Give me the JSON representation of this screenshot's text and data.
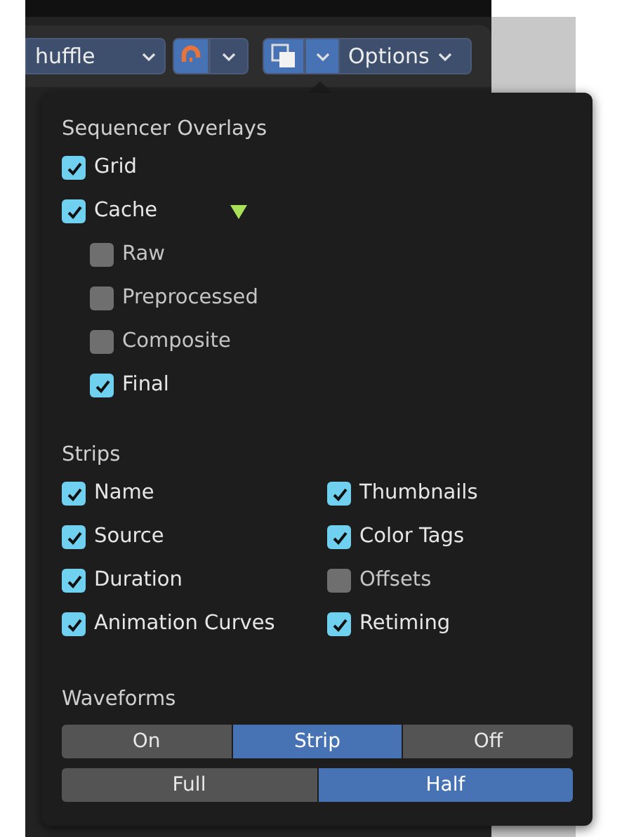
{
  "header": {
    "transform_menu": {
      "label": "huffle"
    },
    "snap_toggle": {
      "on": true
    },
    "overlay_toggle": {
      "on": true
    },
    "options_menu": {
      "label": "Options"
    }
  },
  "popover": {
    "title": "Sequencer Overlays",
    "items": [
      {
        "label": "Grid",
        "checked": true
      },
      {
        "label": "Cache",
        "checked": true,
        "children": [
          {
            "label": "Raw",
            "checked": false
          },
          {
            "label": "Preprocessed",
            "checked": false
          },
          {
            "label": "Composite",
            "checked": false
          },
          {
            "label": "Final",
            "checked": true
          }
        ]
      }
    ],
    "strips": {
      "title": "Strips",
      "items": [
        {
          "label": "Name",
          "checked": true
        },
        {
          "label": "Thumbnails",
          "checked": true
        },
        {
          "label": "Source",
          "checked": true
        },
        {
          "label": "Color Tags",
          "checked": true
        },
        {
          "label": "Duration",
          "checked": true
        },
        {
          "label": "Offsets",
          "checked": false
        },
        {
          "label": "Animation Curves",
          "checked": true
        },
        {
          "label": "Retiming",
          "checked": true
        }
      ]
    },
    "waveforms": {
      "title": "Waveforms",
      "display": [
        {
          "label": "On",
          "selected": false
        },
        {
          "label": "Strip",
          "selected": true
        },
        {
          "label": "Off",
          "selected": false
        }
      ],
      "style": [
        {
          "label": "Full",
          "selected": false
        },
        {
          "label": "Half",
          "selected": true
        }
      ]
    }
  }
}
